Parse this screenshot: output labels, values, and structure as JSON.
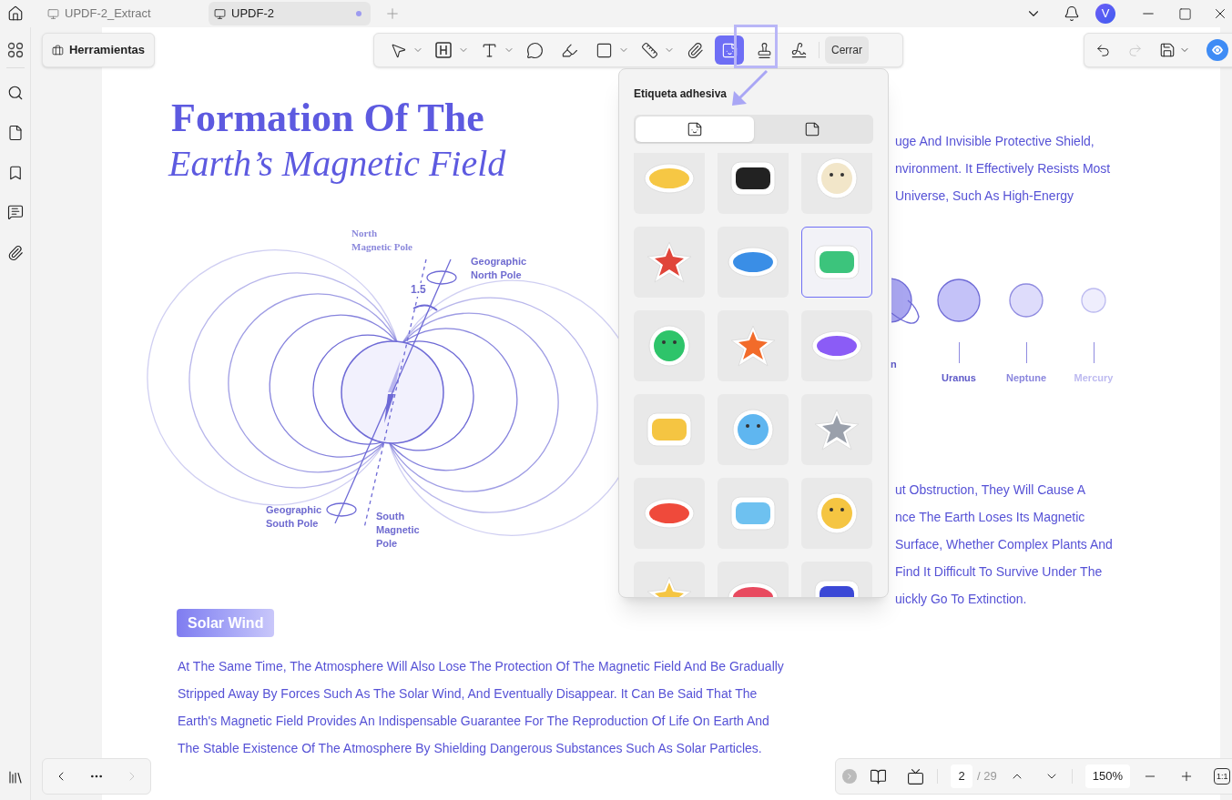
{
  "tabs": [
    {
      "label": "UPDF-2_Extract",
      "selected": false,
      "unsaved": false
    },
    {
      "label": "UPDF-2",
      "selected": true,
      "unsaved": true
    }
  ],
  "user": {
    "initial": "V"
  },
  "tools_button": {
    "label": "Herramientas"
  },
  "toolbar": {
    "tools": [
      {
        "kind": "select",
        "has_menu": true,
        "selected": false
      },
      {
        "kind": "textbox",
        "has_menu": true,
        "selected": false
      },
      {
        "kind": "text",
        "has_menu": true,
        "selected": false
      },
      {
        "kind": "comment",
        "has_menu": false,
        "selected": false
      },
      {
        "kind": "highlight",
        "has_menu": false,
        "selected": false
      },
      {
        "kind": "shape",
        "has_menu": true,
        "selected": false
      },
      {
        "kind": "measure",
        "has_menu": true,
        "selected": false
      },
      {
        "kind": "attach",
        "has_menu": false,
        "selected": false
      },
      {
        "kind": "sticker",
        "has_menu": false,
        "selected": true
      },
      {
        "kind": "stamp",
        "has_menu": false,
        "selected": false
      },
      {
        "kind": "signature",
        "has_menu": false,
        "selected": false
      }
    ],
    "close_label": "Cerrar"
  },
  "right_toolbar": {
    "redo_disabled": true
  },
  "document": {
    "title": "Formation Of The",
    "subtitle": "Earth’s Magnetic Field",
    "diagram_labels": [
      {
        "kind": "serif",
        "lines": [
          "North",
          "Magnetic Pole"
        ]
      },
      {
        "kind": "sans",
        "lines": [
          "Geographic",
          "North Pole"
        ]
      },
      {
        "kind": "angle",
        "lines": [
          "1.5"
        ]
      },
      {
        "kind": "sans",
        "lines": [
          "Geographic",
          "South Pole"
        ]
      },
      {
        "kind": "sans",
        "lines": [
          "South",
          "Magnetic",
          "Pole"
        ]
      }
    ],
    "right_lines_top": [
      "uge And Invisible Protective Shield,",
      "nvironment. It Effectively Resists Most",
      "Universe, Such As High-Energy"
    ],
    "planets": [
      {
        "name": "n",
        "color": "#a9a6f0"
      },
      {
        "name": "Uranus",
        "color": "#c4c2f8"
      },
      {
        "name": "Neptune",
        "color": "#dedcfb"
      },
      {
        "name": "Mercury",
        "color": "#efeefd"
      }
    ],
    "right_lines_bottom": [
      "ut Obstruction, They Will Cause A",
      "nce The Earth Loses Its Magnetic",
      "Surface, Whether Complex Plants And",
      "Find It Difficult To Survive Under The",
      "uickly Go To Extinction."
    ],
    "section_heading": "Solar Wind",
    "paragraph_lines": [
      "At The Same Time, The Atmosphere Will Also Lose The Protection Of The Magnetic Field And Be Gradually",
      "Stripped Away By Forces Such As The Solar Wind, And Eventually Disappear. It Can Be Said That The",
      "Earth's Magnetic Field Provides An Indispensable Guarantee For The Reproduction Of Life On Earth And",
      "The Stable Existence Of The Atmosphere By Shielding Dangerous Substances Such As Solar Particles."
    ]
  },
  "sticker_popup": {
    "title": "Etiqueta adhesiva",
    "tabs": [
      {
        "kind": "stickers",
        "selected": true
      },
      {
        "kind": "custom",
        "selected": false
      }
    ],
    "stickers": [
      {
        "selected": false
      },
      {
        "selected": false
      },
      {
        "selected": false
      },
      {
        "selected": false
      },
      {
        "selected": false
      },
      {
        "selected": true
      },
      {
        "selected": false
      },
      {
        "selected": false
      },
      {
        "selected": false
      },
      {
        "selected": false
      },
      {
        "selected": false
      },
      {
        "selected": false
      },
      {
        "selected": false
      },
      {
        "selected": false
      },
      {
        "selected": false
      },
      {
        "selected": false
      },
      {
        "selected": false
      },
      {
        "selected": false
      }
    ]
  },
  "page_nav": {
    "next_disabled": true
  },
  "status_bar": {
    "page": "2",
    "total": "/ 29",
    "zoom": "150%",
    "actual_size": "1:1"
  }
}
